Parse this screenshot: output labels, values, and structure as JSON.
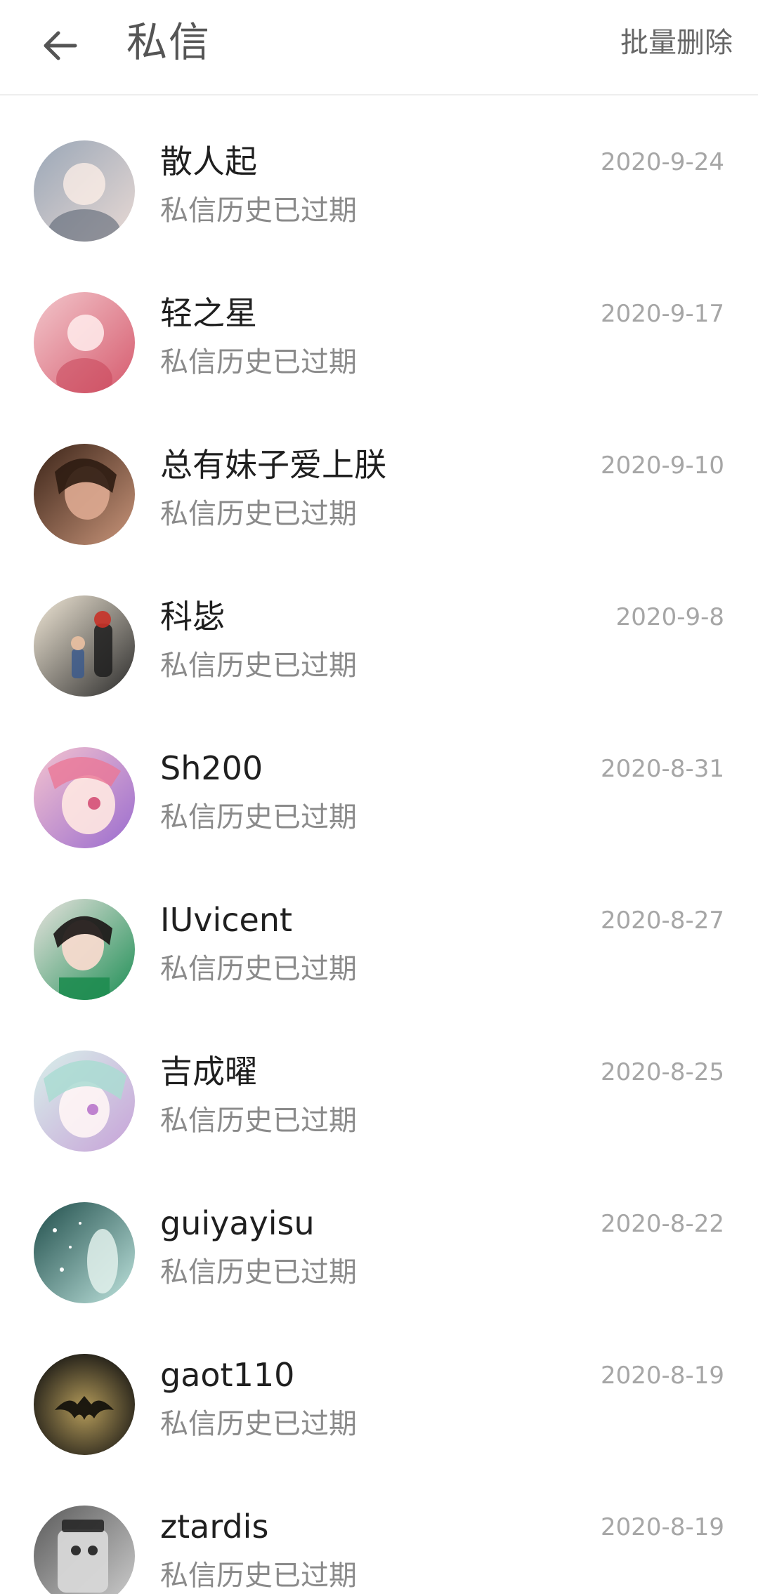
{
  "header": {
    "title": "私信",
    "bulk_delete": "批量删除",
    "back_icon": "arrow-left-icon"
  },
  "messages": [
    {
      "name": "散人起",
      "date": "2020-9-24",
      "preview": "私信历史已过期",
      "avatar_colors": [
        "#9aa7b7",
        "#e8d9d4"
      ]
    },
    {
      "name": "轻之星",
      "date": "2020-9-17",
      "preview": "私信历史已过期",
      "avatar_colors": [
        "#f2c6cb",
        "#d65b6e"
      ]
    },
    {
      "name": "总有妹子爱上朕",
      "date": "2020-9-10",
      "preview": "私信历史已过期",
      "avatar_colors": [
        "#3b2418",
        "#c9957a"
      ]
    },
    {
      "name": "科毖",
      "date": "2020-9-8",
      "preview": "私信历史已过期",
      "avatar_colors": [
        "#f1e8d7",
        "#2a2a2a"
      ]
    },
    {
      "name": "Sh200",
      "date": "2020-8-31",
      "preview": "私信历史已过期",
      "avatar_colors": [
        "#f4c3cf",
        "#9a6ccf"
      ]
    },
    {
      "name": "IUvicent",
      "date": "2020-8-27",
      "preview": "私信历史已过期",
      "avatar_colors": [
        "#e9e3df",
        "#1f8f56"
      ]
    },
    {
      "name": "吉成曜",
      "date": "2020-8-25",
      "preview": "私信历史已过期",
      "avatar_colors": [
        "#d8f0ea",
        "#c7a2d8"
      ]
    },
    {
      "name": "guiyayisu",
      "date": "2020-8-22",
      "preview": "私信历史已过期",
      "avatar_colors": [
        "#1f4d4a",
        "#bfe4de"
      ]
    },
    {
      "name": "gaot110",
      "date": "2020-8-19",
      "preview": "私信历史已过期",
      "avatar_colors": [
        "#1d1b16",
        "#b49b5a"
      ]
    },
    {
      "name": "ztardis",
      "date": "2020-8-19",
      "preview": "私信历史已过期",
      "avatar_colors": [
        "#5a5a5a",
        "#cfcfcf"
      ]
    }
  ]
}
